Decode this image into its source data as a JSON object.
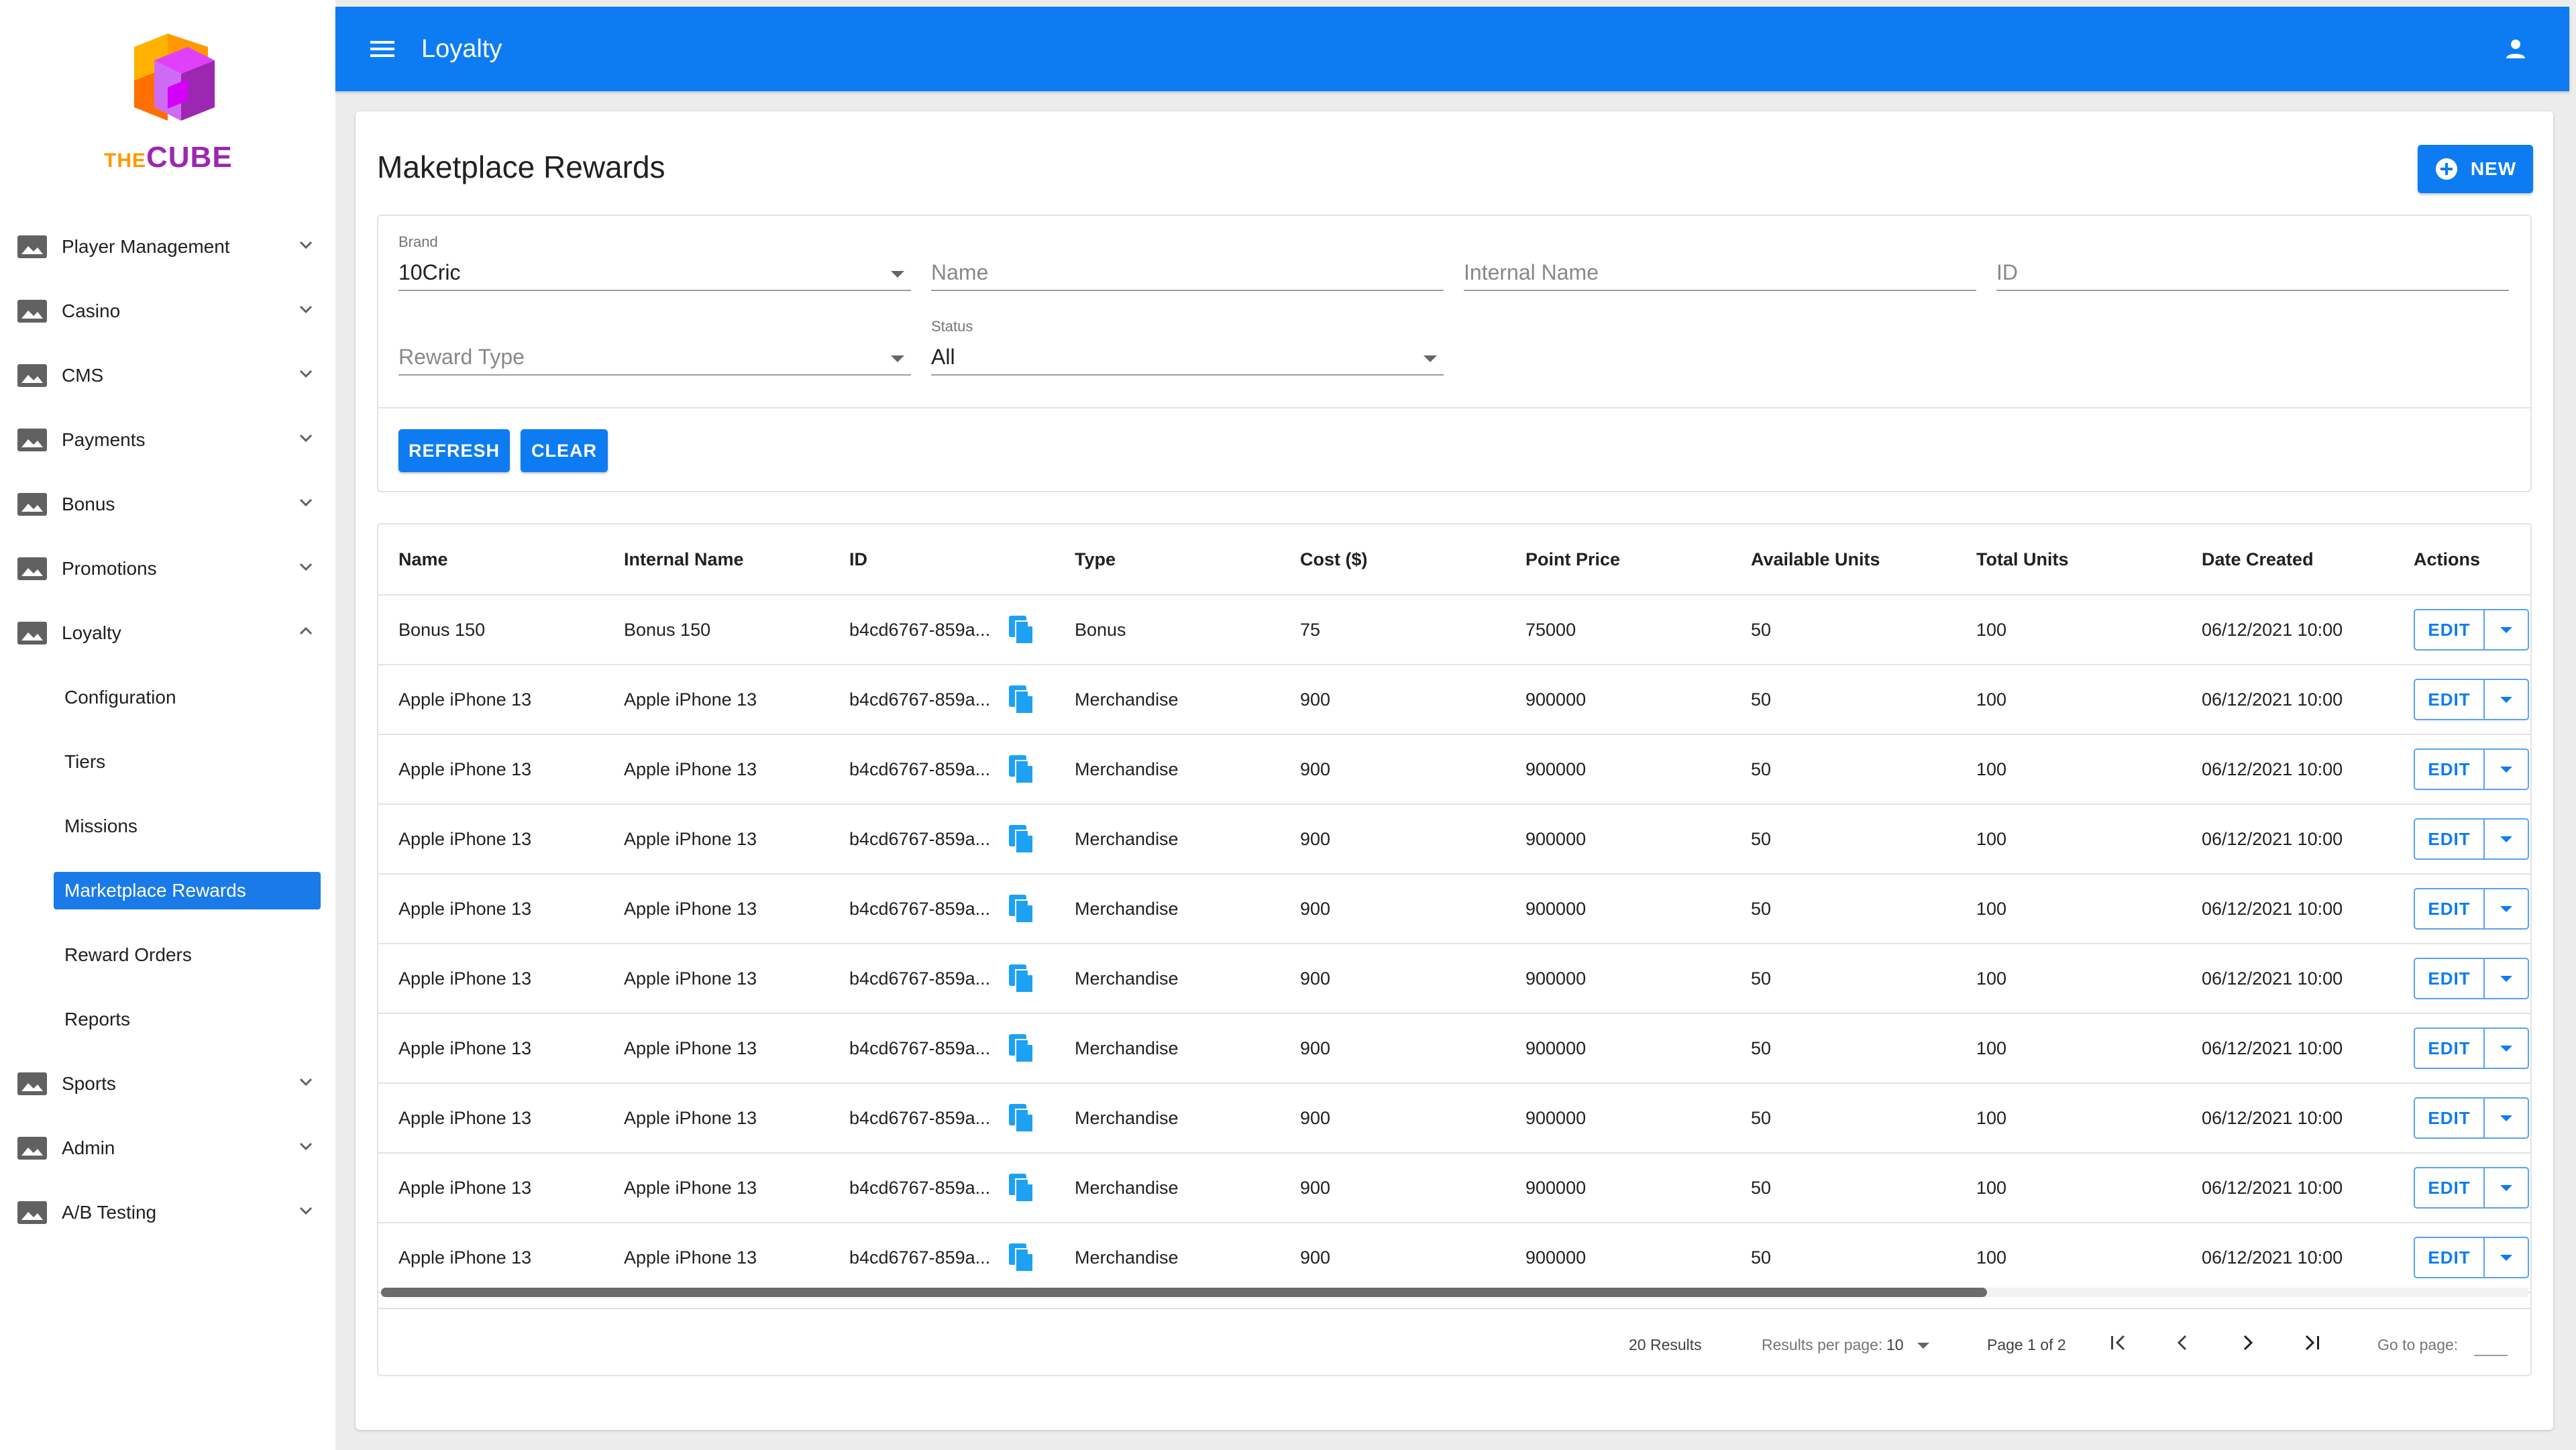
{
  "brand": {
    "the": "THE",
    "cube": "CUBE"
  },
  "sidebar": {
    "items": [
      {
        "label": "Player Management",
        "icon": "image-icon",
        "expanded": false
      },
      {
        "label": "Casino",
        "icon": "image-icon",
        "expanded": false
      },
      {
        "label": "CMS",
        "icon": "image-icon",
        "expanded": false
      },
      {
        "label": "Payments",
        "icon": "image-icon",
        "expanded": false
      },
      {
        "label": "Bonus",
        "icon": "image-icon",
        "expanded": false
      },
      {
        "label": "Promotions",
        "icon": "image-icon",
        "expanded": false
      },
      {
        "label": "Loyalty",
        "icon": "image-icon",
        "expanded": true
      }
    ],
    "loyalty_sub": [
      "Configuration",
      "Tiers",
      "Missions",
      "Marketplace Rewards",
      "Reward Orders",
      "Reports"
    ],
    "active_sub": "Marketplace Rewards",
    "items_after": [
      {
        "label": "Sports",
        "icon": "image-icon",
        "expanded": false
      },
      {
        "label": "Admin",
        "icon": "image-icon",
        "expanded": false
      },
      {
        "label": "A/B Testing",
        "icon": "image-icon",
        "expanded": false
      }
    ]
  },
  "header": {
    "title": "Loyalty",
    "menu_icon": "hamburger-icon",
    "user_icon": "account-icon",
    "color": "#0d7cf2"
  },
  "page": {
    "title": "Maketplace Rewards",
    "new_label": "NEW"
  },
  "filters": {
    "brand": {
      "label": "Brand",
      "value": "10Cric"
    },
    "name": {
      "placeholder": "Name"
    },
    "internal_name": {
      "placeholder": "Internal Name"
    },
    "id": {
      "placeholder": "ID"
    },
    "reward_type": {
      "placeholder": "Reward Type"
    },
    "status": {
      "label": "Status",
      "value": "All"
    },
    "refresh_label": "REFRESH",
    "clear_label": "CLEAR"
  },
  "table": {
    "headers": [
      "Name",
      "Internal Name",
      "ID",
      "Type",
      "Cost ($)",
      "Point Price",
      "Available Units",
      "Total Units",
      "Date Created",
      "Actions"
    ],
    "edit_label": "EDIT",
    "rows": [
      {
        "name": "Bonus 150",
        "internal": "Bonus 150",
        "id": "b4cd6767-859a...",
        "type": "Bonus",
        "cost": "75",
        "points": "75000",
        "available": "50",
        "total": "100",
        "date": "06/12/2021 10:00"
      },
      {
        "name": "Apple iPhone 13",
        "internal": "Apple iPhone 13",
        "id": "b4cd6767-859a...",
        "type": "Merchandise",
        "cost": "900",
        "points": "900000",
        "available": "50",
        "total": "100",
        "date": "06/12/2021 10:00"
      },
      {
        "name": "Apple iPhone 13",
        "internal": "Apple iPhone 13",
        "id": "b4cd6767-859a...",
        "type": "Merchandise",
        "cost": "900",
        "points": "900000",
        "available": "50",
        "total": "100",
        "date": "06/12/2021 10:00"
      },
      {
        "name": "Apple iPhone 13",
        "internal": "Apple iPhone 13",
        "id": "b4cd6767-859a...",
        "type": "Merchandise",
        "cost": "900",
        "points": "900000",
        "available": "50",
        "total": "100",
        "date": "06/12/2021 10:00"
      },
      {
        "name": "Apple iPhone 13",
        "internal": "Apple iPhone 13",
        "id": "b4cd6767-859a...",
        "type": "Merchandise",
        "cost": "900",
        "points": "900000",
        "available": "50",
        "total": "100",
        "date": "06/12/2021 10:00"
      },
      {
        "name": "Apple iPhone 13",
        "internal": "Apple iPhone 13",
        "id": "b4cd6767-859a...",
        "type": "Merchandise",
        "cost": "900",
        "points": "900000",
        "available": "50",
        "total": "100",
        "date": "06/12/2021 10:00"
      },
      {
        "name": "Apple iPhone 13",
        "internal": "Apple iPhone 13",
        "id": "b4cd6767-859a...",
        "type": "Merchandise",
        "cost": "900",
        "points": "900000",
        "available": "50",
        "total": "100",
        "date": "06/12/2021 10:00"
      },
      {
        "name": "Apple iPhone 13",
        "internal": "Apple iPhone 13",
        "id": "b4cd6767-859a...",
        "type": "Merchandise",
        "cost": "900",
        "points": "900000",
        "available": "50",
        "total": "100",
        "date": "06/12/2021 10:00"
      },
      {
        "name": "Apple iPhone 13",
        "internal": "Apple iPhone 13",
        "id": "b4cd6767-859a...",
        "type": "Merchandise",
        "cost": "900",
        "points": "900000",
        "available": "50",
        "total": "100",
        "date": "06/12/2021 10:00"
      },
      {
        "name": "Apple iPhone 13",
        "internal": "Apple iPhone 13",
        "id": "b4cd6767-859a...",
        "type": "Merchandise",
        "cost": "900",
        "points": "900000",
        "available": "50",
        "total": "100",
        "date": "06/12/2021 10:00"
      }
    ]
  },
  "pagination": {
    "results": "20 Results",
    "per_page_label": "Results per page:",
    "per_page_value": "10",
    "page_label": "Page 1 of 2",
    "goto_label": "Go to page:"
  }
}
